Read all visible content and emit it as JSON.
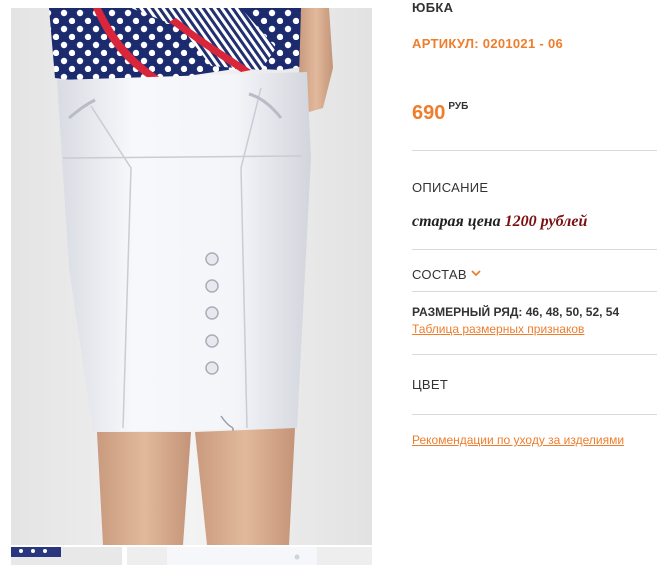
{
  "product": {
    "title": "ЮБКА",
    "sku": "АРТИКУЛ: 0201021 - 06",
    "price": "690",
    "currency": "РУБ"
  },
  "description": {
    "label": "ОПИСАНИЕ",
    "old_price_prefix": "старая цена",
    "old_price_value": "1200 рублей"
  },
  "composition": {
    "label": "СОСТАВ"
  },
  "sizes": {
    "label": "РАЗМЕРНЫЙ РЯД:",
    "values": "46, 48, 50, 52, 54",
    "table_link": "Таблица размерных признаков"
  },
  "color": {
    "label": "ЦВЕТ"
  },
  "care_link": "Рекомендации по уходу за изделиями",
  "accent_color": "#ee7d2c",
  "icons": [
    "chevron-down-icon"
  ]
}
